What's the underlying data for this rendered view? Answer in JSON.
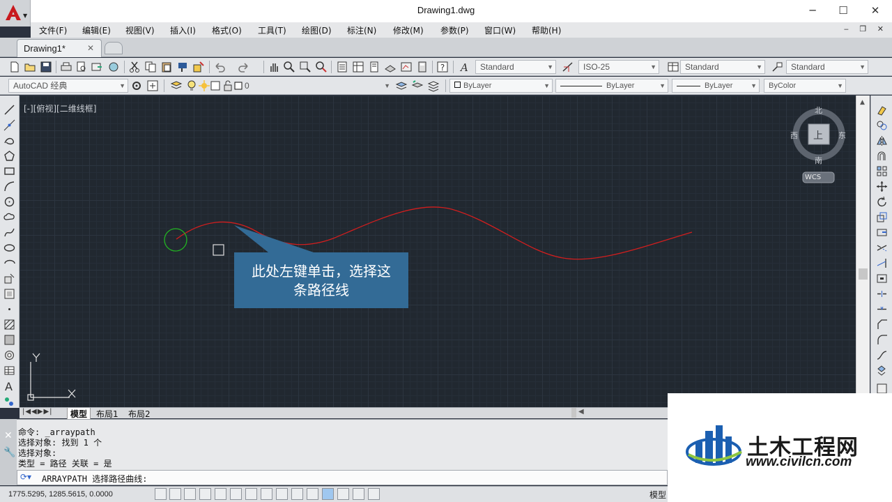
{
  "window": {
    "title": "Drawing1.dwg",
    "minimize": "─",
    "maximize": "☐",
    "close": "✕"
  },
  "menu": [
    "文件(F)",
    "编辑(E)",
    "视图(V)",
    "插入(I)",
    "格式(O)",
    "工具(T)",
    "绘图(D)",
    "标注(N)",
    "修改(M)",
    "参数(P)",
    "窗口(W)",
    "帮助(H)"
  ],
  "tab": {
    "label": "Drawing1*",
    "close": "✕"
  },
  "styles": {
    "text": "Standard",
    "dim": "ISO-25",
    "table": "Standard",
    "mleader": "Standard"
  },
  "workspace": "AutoCAD 经典",
  "layer": "0",
  "properties": {
    "color": "ByLayer",
    "linetype": "ByLayer",
    "lineweight": "ByLayer",
    "plotstyle": "ByColor"
  },
  "viewport_label": "[-][俯视][二维线框]",
  "viewcube": {
    "top": "上",
    "north": "北",
    "south": "南",
    "east": "东",
    "west": "西",
    "wcs": "WCS"
  },
  "ucs": {
    "x": "X",
    "y": "Y"
  },
  "callout": {
    "line1": "此处左键单击，选择这",
    "line2": "条路径线"
  },
  "layout_tabs": [
    "模型",
    "布局1",
    "布局2"
  ],
  "command_history": [
    "命令: _arraypath",
    "选择对象: 找到 1 个",
    "选择对象:",
    "类型 = 路径  关联 = 是"
  ],
  "command_prompt": "ARRAYPATH 选择路径曲线:",
  "coordinates": "1775.5295, 1285.5615, 0.0000",
  "status_model": "模型",
  "watermark": {
    "title": "土木工程网",
    "url": "www.civilcn.com"
  },
  "colors": {
    "curve": "#d21e1e",
    "canvas": "#212830",
    "callout": "#336b96",
    "pickbox": "#e0e0e0",
    "circle": "#22b522"
  }
}
